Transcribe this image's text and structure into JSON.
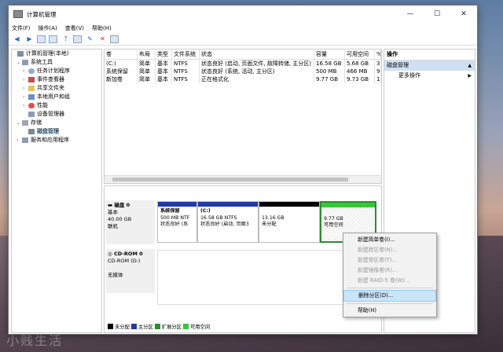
{
  "window": {
    "title": "计算机管理"
  },
  "menu": [
    "文件(F)",
    "操作(A)",
    "查看(V)",
    "帮助(H)"
  ],
  "tree": {
    "root": "计算机管理(本地)",
    "system_tools": "系统工具",
    "task_scheduler": "任务计划程序",
    "event_viewer": "事件查看器",
    "shared_folders": "共享文件夹",
    "local_users": "本地用户和组",
    "performance": "性能",
    "device_manager": "设备管理器",
    "storage": "存储",
    "disk_management": "磁盘管理",
    "services_apps": "服务和应用程序"
  },
  "volumes": {
    "headers": [
      "卷",
      "布局",
      "类型",
      "文件系统",
      "状态",
      "容量",
      "可用空间",
      "%"
    ],
    "rows": [
      [
        "(C:)",
        "简单",
        "基本",
        "NTFS",
        "状态良好 (启动, 页面文件, 故障转储, 主分区)",
        "16.58 GB",
        "5.68 GB",
        "3"
      ],
      [
        "系统保留",
        "简单",
        "基本",
        "NTFS",
        "状态良好 (系统, 活动, 主分区)",
        "500 MB",
        "466 MB",
        "9"
      ],
      [
        "新加卷",
        "简单",
        "基本",
        "NTFS",
        "正在格式化",
        "9.77 GB",
        "9.73 GB",
        "1"
      ]
    ]
  },
  "disk0": {
    "name": "磁盘 0",
    "type": "基本",
    "size": "40.00 GB",
    "status": "联机",
    "partitions": [
      {
        "name": "系统保留",
        "size": "500 MB NTF",
        "status": "状态良好 (系",
        "color": "#1f3aa6"
      },
      {
        "name": "(C:)",
        "size": "16.58 GB NTFS",
        "status": "状态良好 (启动, 页面3",
        "color": "#1f3aa6"
      },
      {
        "name": "",
        "size": "13.16 GB",
        "status": "未分配",
        "color": "#000000"
      },
      {
        "name": "",
        "size": "9.77 GB",
        "status": "可用空间",
        "color": "#38c738"
      }
    ]
  },
  "cdrom0": {
    "name": "CD-ROM 0",
    "drive": "CD-ROM (D:)",
    "status": "无媒体"
  },
  "legend": [
    {
      "label": "未分配",
      "color": "#000000"
    },
    {
      "label": "主分区",
      "color": "#1f3aa6"
    },
    {
      "label": "扩展分区",
      "color": "#2e8b2e"
    },
    {
      "label": "可用空间",
      "color": "#38c738"
    }
  ],
  "actions": {
    "header": "操作",
    "section": "磁盘管理",
    "more": "更多操作"
  },
  "context_menu": {
    "new_simple": "新建简单卷(I)...",
    "new_spanned": "新建跨区卷(N)...",
    "new_striped": "新建带区卷(T)...",
    "new_mirrored": "新建镜像卷(R)...",
    "new_raid5": "新建 RAID-5 卷(W)...",
    "delete_partition": "删除分区(D)...",
    "help": "帮助(H)"
  },
  "watermark": "小贱生活"
}
